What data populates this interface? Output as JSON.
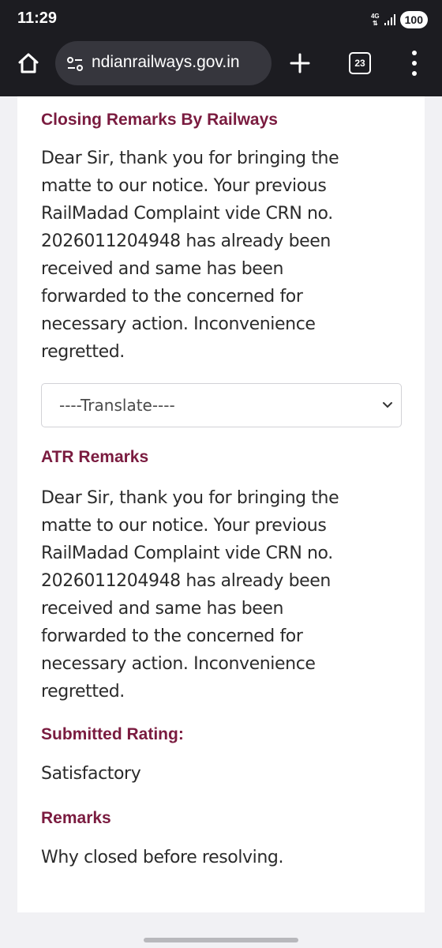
{
  "status_bar": {
    "time": "11:29",
    "network": "4G",
    "battery": "100"
  },
  "browser": {
    "url": "ndianrailways.gov.in",
    "tab_count": "23",
    "icons": {
      "home": "home-icon",
      "site_settings": "tune-icon",
      "new_tab": "plus-icon",
      "menu": "more-vert-icon"
    }
  },
  "closing_remarks": {
    "heading": "Closing Remarks By Railways",
    "lines": [
      "Dear Sir, thank you for bringing the",
      "matte to our notice. Your previous",
      "RailMadad Complaint vide CRN no.",
      "2026011204948 has already been",
      "received and same has been",
      "forwarded to the concerned for",
      "necessary action. Inconvenience",
      "regretted."
    ]
  },
  "translate": {
    "selected": "----Translate----"
  },
  "atr_remarks": {
    "heading": "ATR Remarks",
    "lines": [
      "Dear Sir, thank you for bringing the",
      "matte to our notice. Your previous",
      "RailMadad Complaint vide CRN no.",
      "2026011204948 has already been",
      "received and same has been",
      "forwarded to the concerned for",
      "necessary action. Inconvenience",
      "regretted."
    ]
  },
  "submitted_rating": {
    "heading": "Submitted Rating:",
    "value": "Satisfactory"
  },
  "remarks": {
    "heading": "Remarks",
    "value": "Why closed before resolving."
  },
  "colors": {
    "heading": "#7a1b3f",
    "toolbar": "#1c1c21",
    "url_bar": "#36363d"
  }
}
